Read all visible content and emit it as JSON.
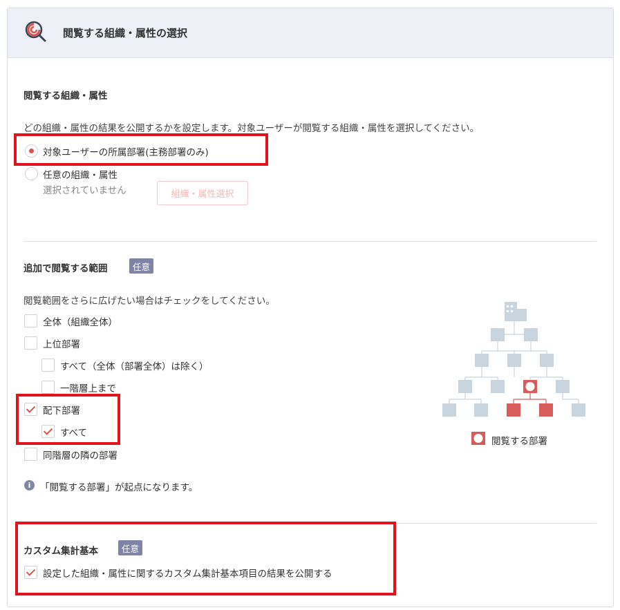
{
  "header": {
    "title": "閲覧する組織・属性の選択",
    "icon": "search-chart-icon"
  },
  "section1": {
    "title": "閲覧する組織・属性",
    "description": "どの組織・属性の結果を公開するかを設定します。対象ユーザーが閲覧する組織・属性を選択してください。",
    "option1_label": "対象ユーザーの所属部署(主務部署のみ)",
    "option1_checked": true,
    "option2_label": "任意の組織・属性",
    "option2_checked": false,
    "option2_status": "選択されていません",
    "select_button": "組織・属性選択"
  },
  "section2": {
    "title": "追加で閲覧する範囲",
    "badge": "任意",
    "description": "閲覧範囲をさらに広げたい場合はチェックをしてください。",
    "options": [
      {
        "label": "全体（組織全体）",
        "checked": false
      },
      {
        "label": "上位部署",
        "checked": false
      },
      {
        "label": "すべて（全体（部署全体）は除く）",
        "checked": false
      },
      {
        "label": "一階層上まで",
        "checked": false
      },
      {
        "label": "配下部署",
        "checked": true
      },
      {
        "label": "すべて",
        "checked": true
      },
      {
        "label": "同階層の隣の部署",
        "checked": false
      }
    ],
    "note": "「閲覧する部署」が起点になります。",
    "legend": "閲覧する部署"
  },
  "section3": {
    "title": "カスタム集計基本",
    "badge": "任意",
    "option_label": "設定した組織・属性に関するカスタム集計基本項目の結果を公開する",
    "option_checked": true
  },
  "colors": {
    "accent": "#d9534f",
    "highlight_box": "#e0141d",
    "node_gray": "#c8d5de",
    "node_red": "#d95c5c",
    "badge": "#8085a8"
  }
}
